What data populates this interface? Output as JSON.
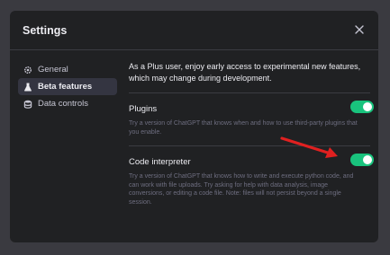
{
  "dialog": {
    "title": "Settings"
  },
  "sidebar": {
    "items": [
      {
        "label": "General",
        "icon": "gear-icon",
        "active": false
      },
      {
        "label": "Beta features",
        "icon": "flask-icon",
        "active": true
      },
      {
        "label": "Data controls",
        "icon": "database-icon",
        "active": false
      }
    ]
  },
  "main": {
    "intro": "As a Plus user, enjoy early access to experimental new features, which may change during development.",
    "features": [
      {
        "label": "Plugins",
        "description": "Try a version of ChatGPT that knows when and how to use third-party plugins that you enable.",
        "enabled": true
      },
      {
        "label": "Code interpreter",
        "description": "Try a version of ChatGPT that knows how to write and execute python code, and can work with file uploads. Try asking for help with data analysis, image conversions, or editing a code file. Note: files will not persist beyond a single session.",
        "enabled": true
      }
    ]
  },
  "colors": {
    "accent": "#19c37d",
    "annotation": "#e02020",
    "background": "#202123"
  }
}
